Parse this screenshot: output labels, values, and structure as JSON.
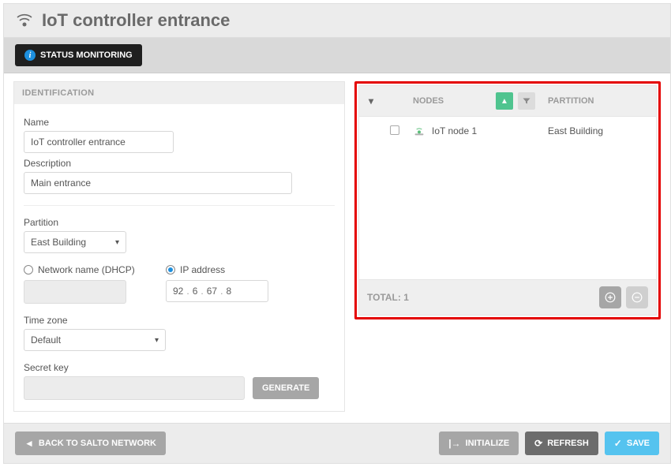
{
  "header": {
    "title": "IoT controller entrance"
  },
  "statusmonitor": {
    "label": "STATUS MONITORING"
  },
  "identification": {
    "title": "IDENTIFICATION",
    "name_label": "Name",
    "name_value": "IoT controller entrance",
    "desc_label": "Description",
    "desc_value": "Main entrance",
    "partition_label": "Partition",
    "partition_value": "East Building",
    "net_dhcp_label": "Network name (DHCP)",
    "net_ip_label": "IP address",
    "net_mode": "ip",
    "ip": {
      "o1": "92",
      "o2": "6",
      "o3": "67",
      "o4": "8"
    },
    "tz_label": "Time zone",
    "tz_value": "Default",
    "secret_label": "Secret key",
    "generate_label": "GENERATE"
  },
  "nodes_panel": {
    "col_nodes": "NODES",
    "col_partition": "PARTITION",
    "rows": [
      {
        "name": "IoT node 1",
        "partition": "East Building"
      }
    ],
    "total_label": "TOTAL:",
    "total_count": "1"
  },
  "footer": {
    "back": "BACK TO SALTO NETWORK",
    "initialize": "INITIALIZE",
    "refresh": "REFRESH",
    "save": "SAVE"
  }
}
